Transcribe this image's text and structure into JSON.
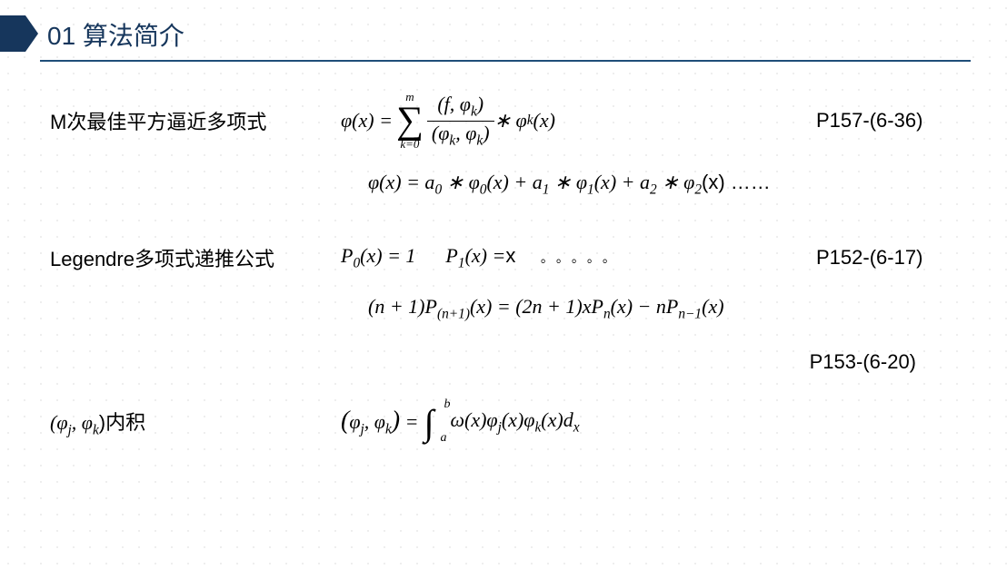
{
  "header": {
    "title": "01 算法简介"
  },
  "rows": {
    "r1_label": "M次最佳平方逼近多项式",
    "r1_ref": "P157-(6-36)",
    "r1_phi": "φ",
    "r1_lhs_x": "(x) = ",
    "r1_sum_top": "m",
    "r1_sum_bot": "k=0",
    "r1_num_f": "(f, φ",
    "r1_num_k": "k",
    "r1_num_end": ")",
    "r1_den_l": "(φ",
    "r1_den_k1": "k",
    "r1_den_mid": ", φ",
    "r1_den_k2": "k",
    "r1_den_end": ")",
    "r1_tail1": " ∗ φ",
    "r1_tail_k": "k",
    "r1_tail2": "(x)",
    "r2_lhs": "φ(x) =  a",
    "r2_a0": "0",
    "r2_p1": " ∗ φ",
    "r2_phi0": "0",
    "r2_p2": "(x) +  a",
    "r2_a1": "1",
    "r2_p3": " ∗ φ",
    "r2_phi1": "1",
    "r2_p4": "(x) + a",
    "r2_a2": "2",
    "r2_p5": " ∗ φ",
    "r2_phi2": "2",
    "r2_tail": "(x) ……",
    "r3_label": "Legendre多项式递推公式",
    "r3_ref": "P152-(6-17)",
    "r3_P": "P",
    "r3_p0s": "0",
    "r3_p0r": "(x) = 1",
    "r3_p1s": "1",
    "r3_p1r": "(x) =",
    "r3_xupright": "x",
    "r3_dots": "。。。。。",
    "r4_lhs1": "(n + 1)P",
    "r4_sub1": "(n+1)",
    "r4_mid1": "(x) = (2n + 1)xP",
    "r4_sub2": "n",
    "r4_mid2": "(x) − nP",
    "r4_sub3": "n−1",
    "r4_tail": "(x)",
    "r5_ref": "P153-(6-20)",
    "r6_label_l": "(φ",
    "r6_label_j": "j",
    "r6_label_m": ", φ",
    "r6_label_k": "k",
    "r6_label_r": ")内积",
    "r6_lhs_l": "(φ",
    "r6_lhs_j": "j",
    "r6_lhs_m": ", φ",
    "r6_lhs_k": "k",
    "r6_lhs_r": ") = ",
    "r6_int_ub": "b",
    "r6_int_lb": "a",
    "r6_body1": "ω(x)φ",
    "r6_body_j": "j",
    "r6_body2": "(x)φ",
    "r6_body_k": "k",
    "r6_body3": "(x)d",
    "r6_body_x": "x"
  }
}
